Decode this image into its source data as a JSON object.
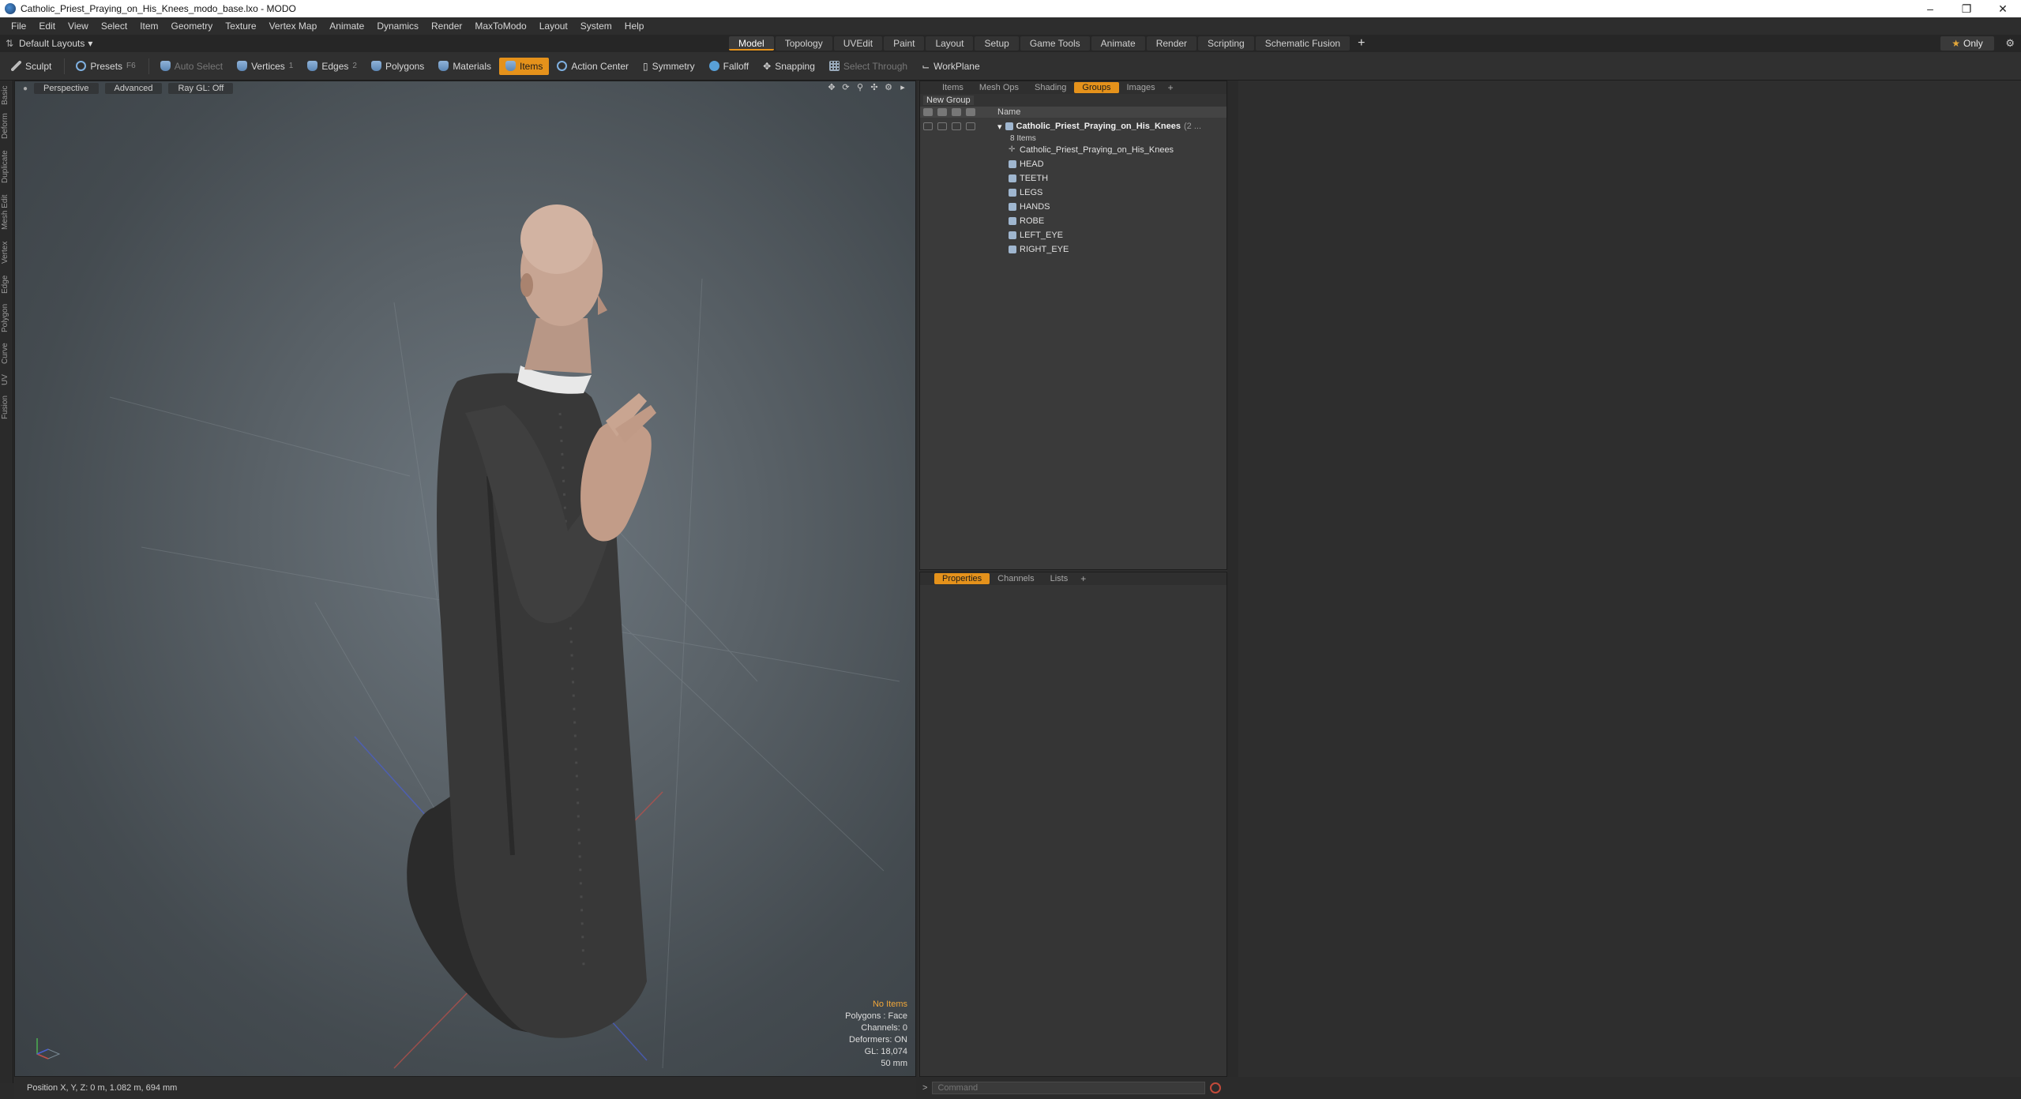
{
  "window": {
    "title": "Catholic_Priest_Praying_on_His_Knees_modo_base.lxo - MODO"
  },
  "menu": [
    "File",
    "Edit",
    "View",
    "Select",
    "Item",
    "Geometry",
    "Texture",
    "Vertex Map",
    "Animate",
    "Dynamics",
    "Render",
    "MaxToModo",
    "Layout",
    "System",
    "Help"
  ],
  "layout_dropdown": "Default Layouts",
  "tabs": [
    {
      "label": "Model",
      "active": true
    },
    {
      "label": "Topology"
    },
    {
      "label": "UVEdit"
    },
    {
      "label": "Paint"
    },
    {
      "label": "Layout"
    },
    {
      "label": "Setup"
    },
    {
      "label": "Game Tools"
    },
    {
      "label": "Animate"
    },
    {
      "label": "Render"
    },
    {
      "label": "Scripting"
    },
    {
      "label": "Schematic Fusion"
    }
  ],
  "only_button": "Only",
  "toolbar": {
    "sculpt": "Sculpt",
    "presets": "Presets",
    "presets_shortcut": "F6",
    "auto_select": "Auto Select",
    "vertices": "Vertices",
    "vertices_shortcut": "1",
    "edges": "Edges",
    "edges_shortcut": "2",
    "polygons": "Polygons",
    "materials": "Materials",
    "items": "Items",
    "action_center": "Action Center",
    "symmetry": "Symmetry",
    "falloff": "Falloff",
    "snapping": "Snapping",
    "select_through": "Select Through",
    "workplane": "WorkPlane"
  },
  "left_strip": [
    "Basic",
    "Deform",
    "Duplicate",
    "Mesh Edit",
    "Vertex",
    "Edge",
    "Polygon",
    "Curve",
    "UV",
    "Fusion"
  ],
  "viewport": {
    "view_mode": "Perspective",
    "shading": "Advanced",
    "raygl": "Ray GL: Off",
    "info": {
      "selection": "No Items",
      "polygons": "Polygons : Face",
      "channels": "Channels: 0",
      "deformers": "Deformers: ON",
      "gl": "GL: 18,074",
      "focal": "50 mm"
    }
  },
  "status": {
    "position": "Position X, Y, Z:   0 m, 1.082 m, 694 mm"
  },
  "groups_panel": {
    "tabs": [
      {
        "label": "Items"
      },
      {
        "label": "Mesh Ops"
      },
      {
        "label": "Shading"
      },
      {
        "label": "Groups",
        "active": true
      },
      {
        "label": "Images"
      }
    ],
    "new_group": "New Group",
    "col_name": "Name",
    "group_name": "Catholic_Priest_Praying_on_His_Knees",
    "group_suffix": "(2 ...",
    "group_count": "8 Items",
    "items": [
      {
        "name": "Catholic_Priest_Praying_on_His_Knees",
        "type": "locator"
      },
      {
        "name": "HEAD",
        "type": "mesh"
      },
      {
        "name": "TEETH",
        "type": "mesh"
      },
      {
        "name": "LEGS",
        "type": "mesh"
      },
      {
        "name": "HANDS",
        "type": "mesh"
      },
      {
        "name": "ROBE",
        "type": "mesh"
      },
      {
        "name": "LEFT_EYE",
        "type": "mesh"
      },
      {
        "name": "RIGHT_EYE",
        "type": "mesh"
      }
    ]
  },
  "props_panel": {
    "tabs": [
      {
        "label": "Properties",
        "active": true
      },
      {
        "label": "Channels"
      },
      {
        "label": "Lists"
      }
    ]
  },
  "command": {
    "placeholder": "Command"
  },
  "colors": {
    "accent": "#e5921b",
    "info_highlight": "#f0a63a"
  }
}
